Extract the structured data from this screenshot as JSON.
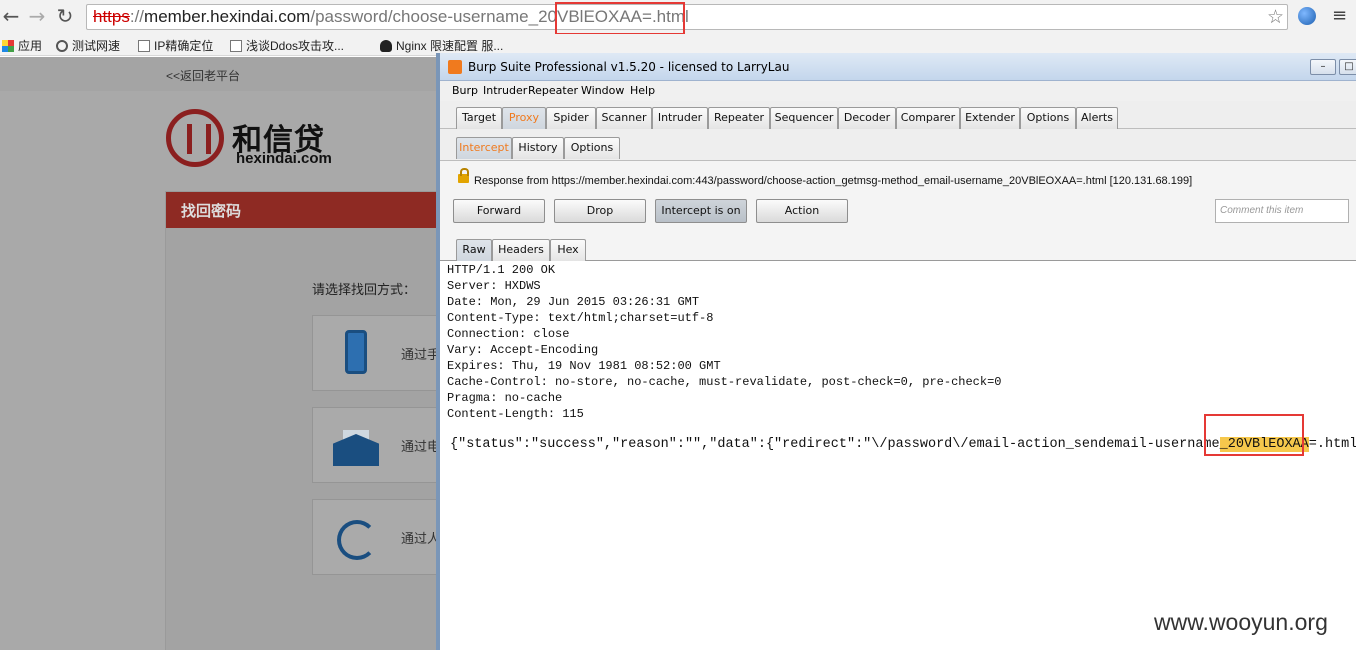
{
  "browser": {
    "url_scheme": "https",
    "url_sep": "://",
    "url_host": "member.hexindai.com",
    "url_path": "/password/choose-username",
    "url_token": "_20VBlEOXAA=",
    "url_suffix": ".html",
    "bookmarks": [
      "应用",
      "测试网速",
      "IP精确定位",
      "浅谈Ddos攻击攻...",
      "Nginx 限速配置 服..."
    ]
  },
  "webpage": {
    "back_link": "<<返回老平台",
    "logo_cn": "和信贷",
    "logo_en": "hexindai.com",
    "panel_title": "找回密码",
    "choose_label": "请选择找回方式：",
    "methods": [
      {
        "label": "通过手",
        "icon": "phone-icon"
      },
      {
        "label": "通过电",
        "icon": "mail-icon"
      },
      {
        "label": "通过人",
        "icon": "call-icon"
      }
    ]
  },
  "burp": {
    "title": "Burp Suite Professional v1.5.20 - licensed to LarryLau",
    "menu": [
      "Burp",
      "Intruder",
      "Repeater",
      "Window",
      "Help"
    ],
    "tabs": [
      "Target",
      "Proxy",
      "Spider",
      "Scanner",
      "Intruder",
      "Repeater",
      "Sequencer",
      "Decoder",
      "Comparer",
      "Extender",
      "Options",
      "Alerts"
    ],
    "active_tab": "Proxy",
    "sub_tabs": [
      "Intercept",
      "History",
      "Options"
    ],
    "active_sub_tab": "Intercept",
    "request_info": "Response from https://member.hexindai.com:443/password/choose-action_getmsg-method_email-username_20VBlEOXAA=.html  [120.131.68.199]",
    "buttons": {
      "forward": "Forward",
      "drop": "Drop",
      "intercept": "Intercept is on",
      "action": "Action"
    },
    "comment_placeholder": "Comment this item",
    "view_tabs": [
      "Raw",
      "Headers",
      "Hex"
    ],
    "response_headers": [
      "HTTP/1.1 200 OK",
      "Server: HXDWS",
      "Date: Mon, 29 Jun 2015 03:26:31 GMT",
      "Content-Type: text/html;charset=utf-8",
      "Connection: close",
      "Vary: Accept-Encoding",
      "Expires: Thu, 19 Nov 1981 08:52:00 GMT",
      "Cache-Control: no-store, no-cache, must-revalidate, post-check=0, pre-check=0",
      "Pragma: no-cache",
      "Content-Length: 115"
    ],
    "body_prefix": "{\"status\":\"success\",\"reason\":\"\",\"data\":{\"redirect\":\"\\/password\\/email-action_sendemail-username",
    "body_token": "_20VBlEOXAA",
    "body_suffix": "=.html\"}}"
  },
  "watermark": "www.wooyun.org",
  "colors": {
    "burp_accent": "#f07a1e",
    "highlight": "#f6c84c",
    "annotation_box": "#e53935",
    "brand_red": "#8e2a23"
  }
}
